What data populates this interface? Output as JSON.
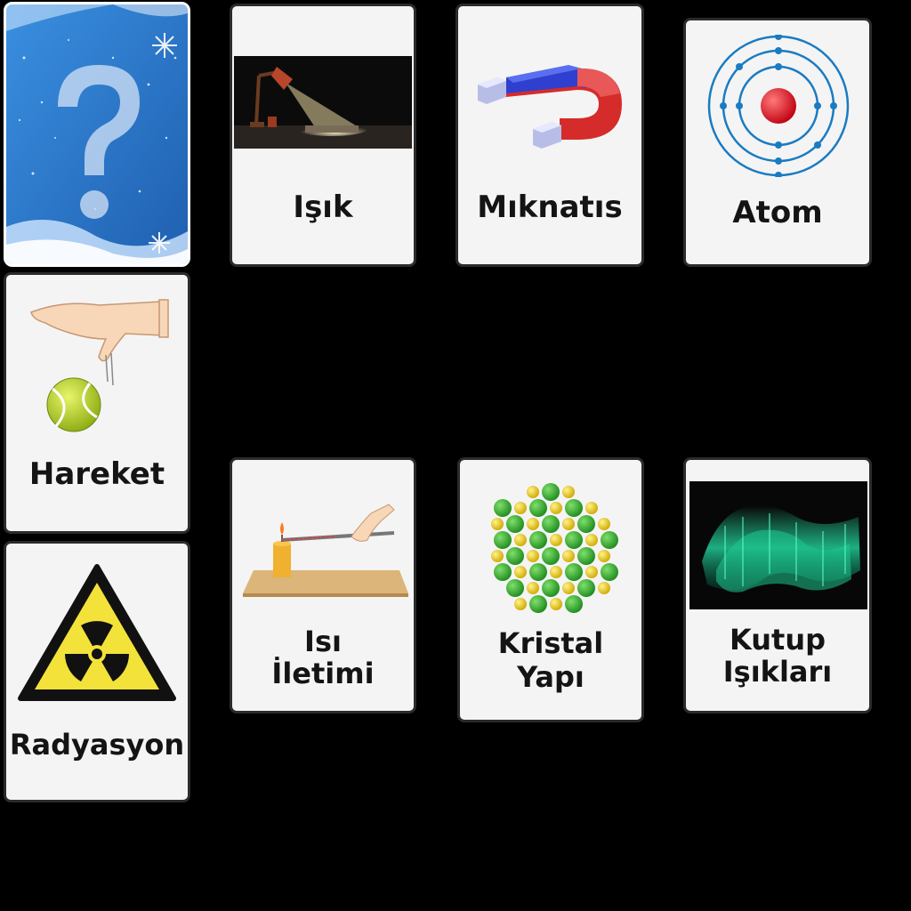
{
  "cards": [
    {
      "id": "back",
      "label": "",
      "face_down": true,
      "icon": "question-mark-icon"
    },
    {
      "id": "isik",
      "label": "Işık",
      "icon": "desk-lamp-icon"
    },
    {
      "id": "miknatis",
      "label": "Mıknatıs",
      "icon": "horseshoe-magnet-icon"
    },
    {
      "id": "atom",
      "label": "Atom",
      "icon": "atom-icon"
    },
    {
      "id": "hareket",
      "label": "Hareket",
      "icon": "falling-ball-icon"
    },
    {
      "id": "radyasyon",
      "label": "Radyasyon",
      "icon": "radiation-warning-icon"
    },
    {
      "id": "isi-iletimi",
      "label_lines": [
        "Isı",
        "İletimi"
      ],
      "icon": "heat-conduction-icon"
    },
    {
      "id": "kristal-yapi",
      "label_lines": [
        "Kristal",
        "Yapı"
      ],
      "icon": "crystal-lattice-icon"
    },
    {
      "id": "kutup-isiklari",
      "label_lines": [
        "Kutup",
        "Işıkları"
      ],
      "icon": "aurora-icon"
    }
  ],
  "colors": {
    "background": "#000000",
    "card_face": "#f4f4f4",
    "card_border": "#2b2b2b",
    "card_back": "#2f7fd0",
    "label": "#141414"
  }
}
